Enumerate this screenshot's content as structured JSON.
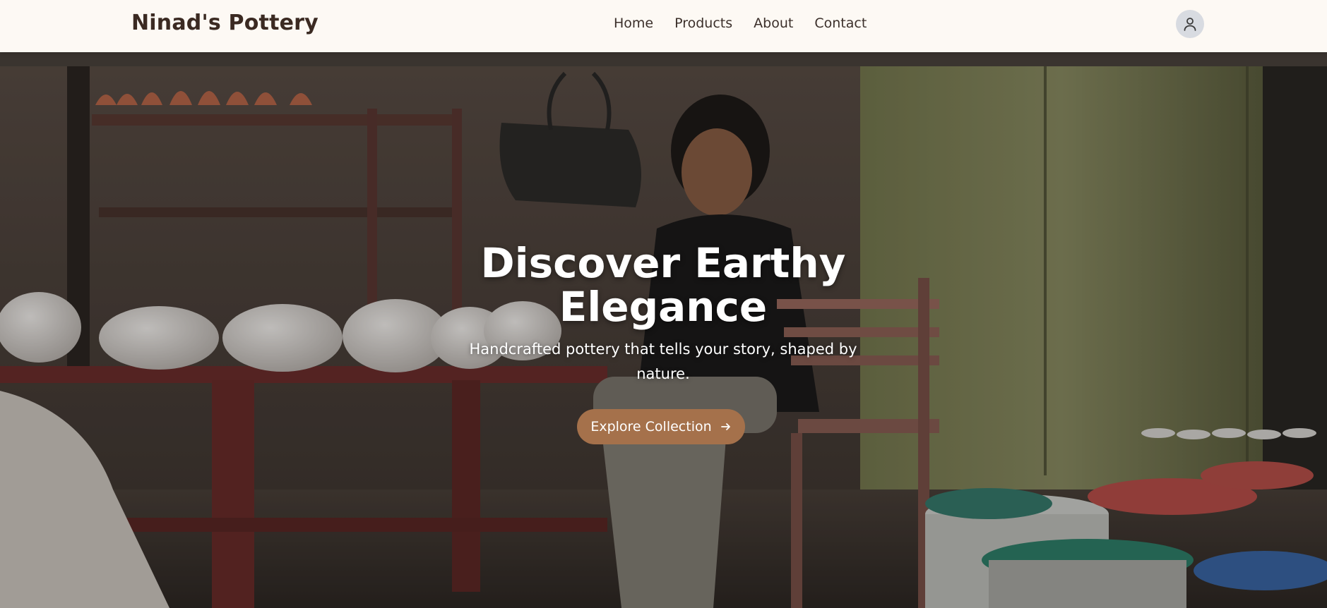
{
  "header": {
    "brand": "Ninad's Pottery",
    "nav": [
      {
        "label": "Home"
      },
      {
        "label": "Products"
      },
      {
        "label": "About"
      },
      {
        "label": "Contact"
      }
    ],
    "avatar_icon": "user-icon"
  },
  "hero": {
    "title": "Discover Earthy Elegance",
    "subtitle": "Handcrafted pottery that tells your story, shaped by nature.",
    "cta_label": "Explore Collection",
    "cta_icon": "arrow-right-icon",
    "background": "photo of a potter seated among pots in a workshop"
  },
  "colors": {
    "header_bg": "#fdf9f4",
    "brand_text": "#3b2a22",
    "accent": "#a5714b",
    "hero_text": "#ffffff"
  }
}
